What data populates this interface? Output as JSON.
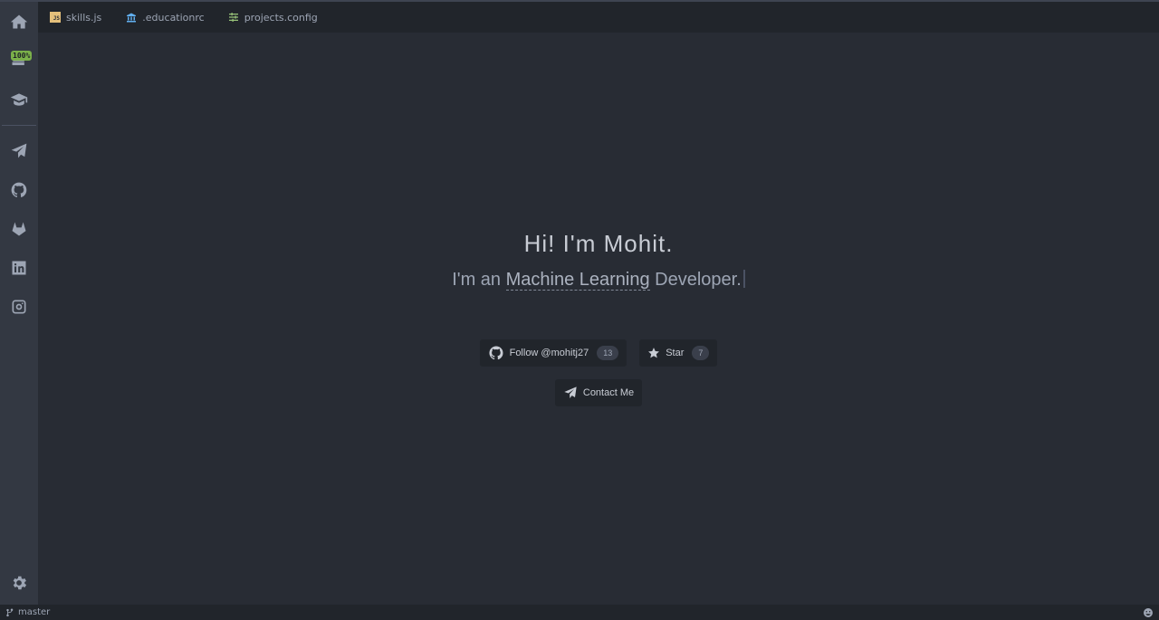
{
  "activity_bar": {
    "badge": "100%"
  },
  "tabs": [
    {
      "label": "skills.js",
      "icon": "js-file-icon",
      "icon_text": "JS"
    },
    {
      "label": ".educationrc",
      "icon": "bank-icon"
    },
    {
      "label": "projects.config",
      "icon": "sliders-icon"
    }
  ],
  "hero": {
    "greeting": "Hi! I'm Mohit.",
    "subtitle_prefix": "I'm an",
    "role": "Machine Learning",
    "subtitle_suffix": "Developer."
  },
  "buttons": {
    "follow_label": "Follow @mohitj27",
    "follow_count": "13",
    "star_label": "Star",
    "star_count": "7",
    "contact_label": "Contact Me"
  },
  "status_bar": {
    "branch": "master"
  },
  "colors": {
    "background": "#282c34",
    "sidebar": "#333842",
    "tabbar": "#21252b",
    "badge": "#7bb04a",
    "js_icon": "#e5c07b",
    "bank_icon": "#61afef",
    "sliders_icon": "#98c379"
  }
}
